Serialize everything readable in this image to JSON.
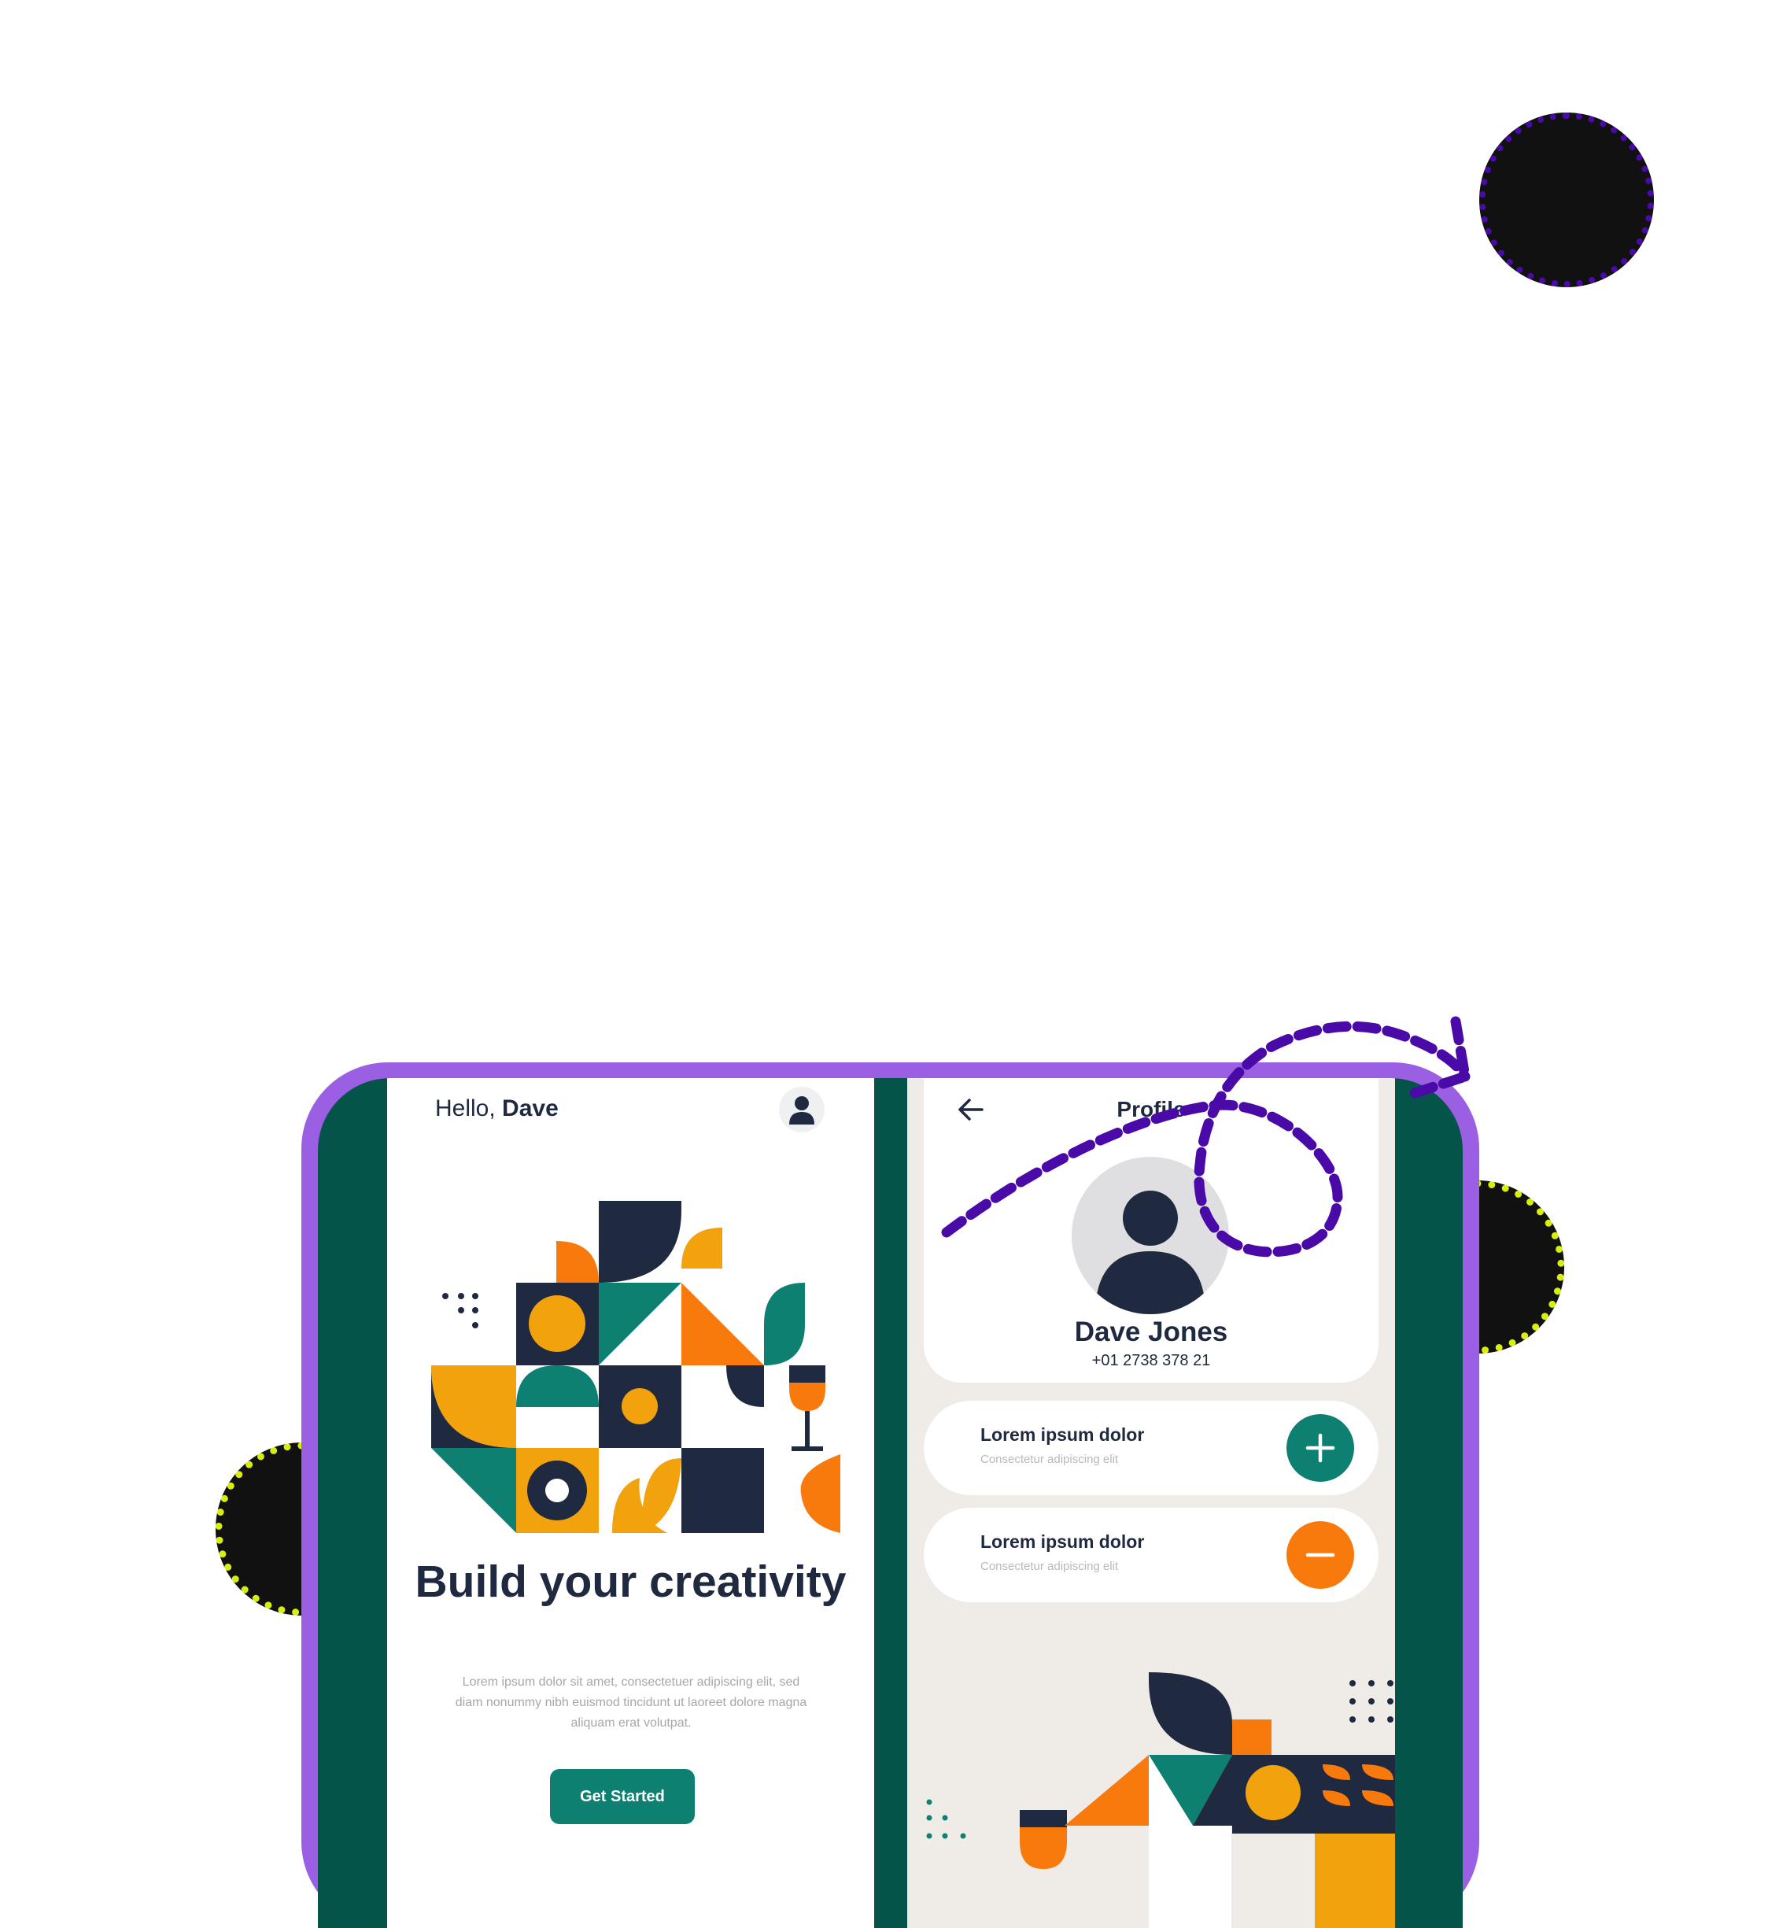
{
  "colors": {
    "background": "#ffffff",
    "frame_border": "#9b5fe3",
    "frame_fill": "#05544a",
    "navy": "#1f2940",
    "teal": "#0d8071",
    "orange": "#f97a0c",
    "mustard": "#f2a20c",
    "doodle_purple": "#4a0aa8",
    "dotted_yellow": "#d7ef0c"
  },
  "home_screen": {
    "greeting_prefix": "Hello, ",
    "greeting_name": "Dave",
    "avatar_icon": "user-icon",
    "headline": "Build your creativity",
    "body": "Lorem ipsum dolor sit amet, consectetuer adipiscing elit, sed diam nonummy nibh euismod tincidunt ut laoreet dolore magna aliquam erat volutpat.",
    "cta_label": "Get Started"
  },
  "profile_screen": {
    "back_icon": "arrow-left-icon",
    "title": "Profile",
    "name": "Dave Jones",
    "phone": "+01 2738 378 21",
    "items": [
      {
        "title": "Lorem ipsum dolor",
        "subtitle": "Consectetur adipiscing elit",
        "action_icon": "plus-icon"
      },
      {
        "title": "Lorem ipsum dolor",
        "subtitle": "Consectetur adipiscing elit",
        "action_icon": "minus-icon"
      }
    ]
  }
}
